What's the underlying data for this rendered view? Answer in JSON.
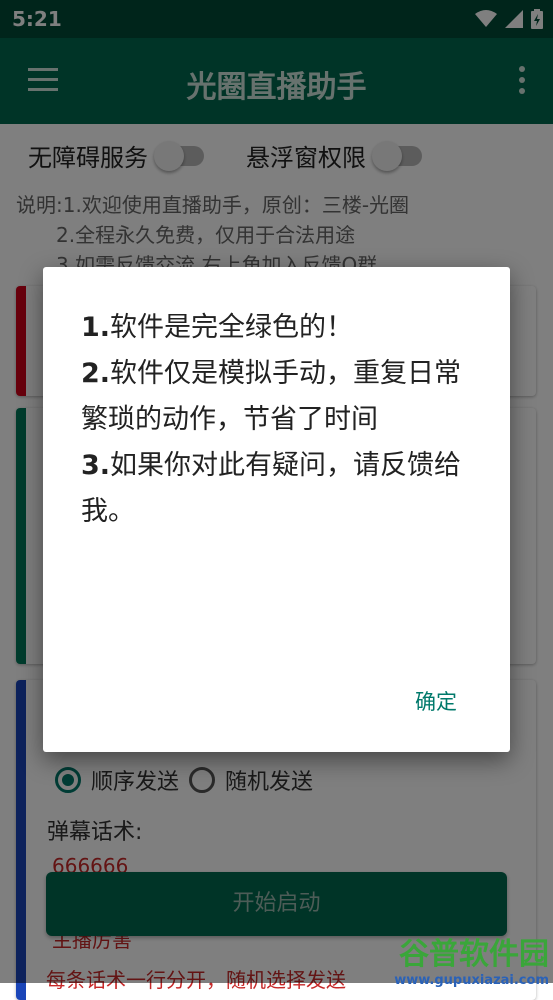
{
  "status_bar": {
    "time": "5:21"
  },
  "app_bar": {
    "title": "光圈直播助手"
  },
  "switches": [
    {
      "label": "无障碍服务",
      "on": false
    },
    {
      "label": "悬浮窗权限",
      "on": false
    }
  ],
  "description": [
    "说明:1.欢迎使用直播助手，原创：三楼-光圈",
    "2.全程永久免费，仅用于合法用途",
    "3.如需反馈交流,右上角加入反馈Q群"
  ],
  "send_mode": {
    "options": [
      "顺序发送",
      "随机发送"
    ],
    "selected": "顺序发送"
  },
  "danmu_label": "弹幕话术:",
  "danmu_value": "666666",
  "start_button": "开始启动",
  "anchor_text": "主播厉害",
  "bottom_hint": "每条话术一行分开，随机选择发送",
  "dialog": {
    "lines": [
      {
        "num": "1.",
        "text": "软件是完全绿色的！"
      },
      {
        "num": "2.",
        "text": "软件仅是模拟手动，重复日常繁琐的动作，节省了时间"
      },
      {
        "num": "3.",
        "text": "如果你对此有疑问，请反馈给我。"
      }
    ],
    "ok_label": "确定"
  },
  "watermark": {
    "name": "谷普软件园",
    "url": "www.gupuxiazai.com"
  },
  "colors": {
    "status_bar": "#004a36",
    "app_bar": "#00694e",
    "accent": "#00796b",
    "card_red": "#d0021b",
    "card_green": "#00795a",
    "card_blue": "#1a45b8"
  }
}
